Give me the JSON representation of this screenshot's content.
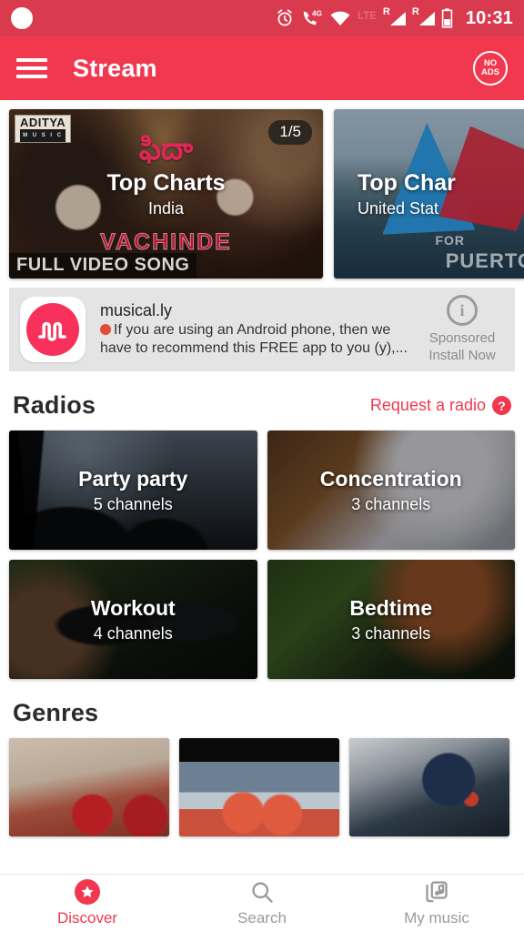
{
  "statusbar": {
    "alarm_icon": "alarm-icon",
    "call_icon": "call-4g-icon",
    "network_label": "4G",
    "wifi_icon": "wifi-icon",
    "lte_label": "LTE",
    "sim1_roam": "R",
    "sim2_roam": "R",
    "battery_icon": "battery-icon",
    "time": "10:31"
  },
  "appbar": {
    "menu_icon": "hamburger-menu-icon",
    "title": "Stream",
    "noads_line1": "NO",
    "noads_line2": "ADS",
    "bg_color": "#f2384f"
  },
  "carousel": {
    "badge": "1/5",
    "cards": [
      {
        "title": "Top Charts",
        "subtitle": "India",
        "art_label_brand": "ADITYA",
        "art_label_brand_sub": "M U S I C",
        "art_label_film": "ఫిదా",
        "art_label_song": "VACHINDE",
        "art_label_footer": "FULL VIDEO SONG"
      },
      {
        "title": "Top Char",
        "subtitle": "United Stat",
        "art_label_for": "FOR",
        "art_label_puerto": "PUERTO"
      }
    ]
  },
  "ad": {
    "app_icon": "musically-app-icon",
    "title": "musical.ly",
    "description": "If you are using an Android phone, then we have to recommend this FREE app to you (y),...",
    "info_icon": "ad-info-icon",
    "sponsored_label": "Sponsored",
    "cta_label": "Install Now",
    "bg_color": "#e4e4e4"
  },
  "radios": {
    "heading": "Radios",
    "request_label": "Request a radio",
    "help_icon": "question-mark-icon",
    "accent_color": "#f2384f",
    "cards": [
      {
        "title": "Party party",
        "subtitle": "5 channels"
      },
      {
        "title": "Concentration",
        "subtitle": "3 channels"
      },
      {
        "title": "Workout",
        "subtitle": "4 channels"
      },
      {
        "title": "Bedtime",
        "subtitle": "3 channels"
      }
    ]
  },
  "genres": {
    "heading": "Genres",
    "cards": [
      {
        "name": "genre-card-1"
      },
      {
        "name": "genre-card-2"
      },
      {
        "name": "genre-card-3"
      }
    ]
  },
  "bottomnav": {
    "items": [
      {
        "label": "Discover",
        "icon": "star-badge-icon",
        "active": true
      },
      {
        "label": "Search",
        "icon": "magnifier-icon",
        "active": false
      },
      {
        "label": "My music",
        "icon": "music-library-icon",
        "active": false
      }
    ],
    "active_color": "#f2384f",
    "inactive_color": "#9a9a9a"
  }
}
